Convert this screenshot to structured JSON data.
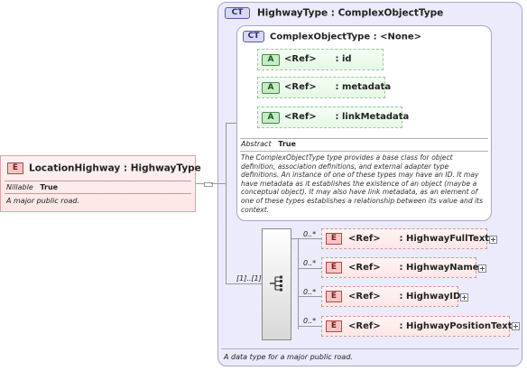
{
  "root_element": {
    "badge": "E",
    "title": "LocationHighway : HighwayType",
    "prop_key": "Nillable",
    "prop_value": "True",
    "doc": "A major public road."
  },
  "outer_type": {
    "badge": "CT",
    "title": "HighwayType : ComplexObjectType",
    "doc": "A data type for a major public road."
  },
  "inner_type": {
    "badge": "CT",
    "title": "ComplexObjectType : <None>",
    "abstract_key": "Abstract",
    "abstract_value": "True",
    "doc": "The ComplexObjectType type provides a base class for object definition, association definitions, and external adapter type definitions. An instance of one of these types may have an ID. It may have metadata as it establishes the existence of an object (maybe a conceptual object). It may also have link metadata, as an element of one of these types establishes a relationship between its value and its context."
  },
  "attributes": [
    {
      "badge": "A",
      "label": "<Ref>      : id"
    },
    {
      "badge": "A",
      "label": "<Ref>      : metadata"
    },
    {
      "badge": "A",
      "label": "<Ref>      : linkMetadata"
    }
  ],
  "sequence": {
    "cardinality": "[1]..[1]",
    "icon": "sequence-icon"
  },
  "children": [
    {
      "badge": "E",
      "label": "<Ref>      : HighwayFullText",
      "cardinality": "0..*"
    },
    {
      "badge": "E",
      "label": "<Ref>      : HighwayName",
      "cardinality": "0..*"
    },
    {
      "badge": "E",
      "label": "<Ref>      : HighwayID",
      "cardinality": "0..*"
    },
    {
      "badge": "E",
      "label": "<Ref>      : HighwayPositionText",
      "cardinality": "0..*"
    }
  ],
  "colors": {
    "element_border": "#b24848",
    "attribute_border": "#4a8a4a",
    "type_fill": "#ebebfb"
  }
}
